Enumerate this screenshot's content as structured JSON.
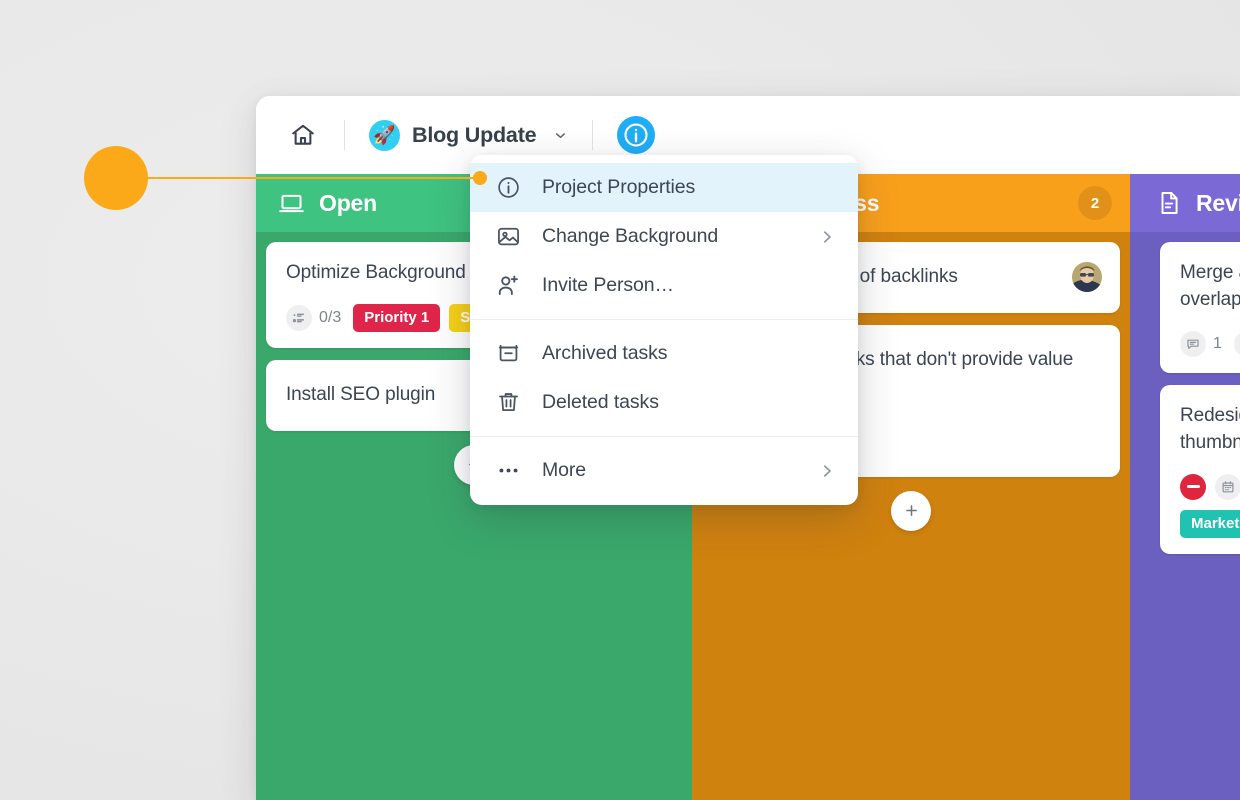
{
  "topbar": {
    "home_icon": "home-icon",
    "project_avatar_glyph": "🚀",
    "project_name": "Blog Update",
    "caret_icon": "chevron-down-icon",
    "info_icon": "info-circle-icon"
  },
  "menu": {
    "items": [
      {
        "label": "Project Properties",
        "icon": "info-circle-icon",
        "active": true,
        "has_submenu": false
      },
      {
        "label": "Change Background",
        "icon": "image-icon",
        "active": false,
        "has_submenu": true
      },
      {
        "label": "Invite Person…",
        "icon": "person-add-icon",
        "active": false,
        "has_submenu": false
      },
      {
        "label": "Archived tasks",
        "icon": "archive-icon",
        "active": false,
        "has_submenu": false
      },
      {
        "label": "Deleted tasks",
        "icon": "trash-icon",
        "active": false,
        "has_submenu": false
      },
      {
        "label": "More",
        "icon": "ellipsis-icon",
        "active": false,
        "has_submenu": true
      }
    ]
  },
  "board": {
    "columns": [
      {
        "title": "Open",
        "icon": "laptop-icon",
        "count": "",
        "header_color": "#3FC380",
        "body_color": "#3AA86B",
        "add_label": "+",
        "cards": [
          {
            "title": "Optimize Background",
            "checklist": "0/3",
            "tags": [
              {
                "label": "Priority 1",
                "color": "#E0254A"
              },
              {
                "label": "SEO",
                "color": "#F7D117"
              }
            ]
          },
          {
            "title": "Install SEO plugin",
            "checklist": "",
            "tags": []
          }
        ]
      },
      {
        "title": "In Progress",
        "icon": "gear-icon",
        "count": "2",
        "header_color": "#F9A01B",
        "body_color": "#D0820F",
        "add_label": "+",
        "cards": [
          {
            "title": "Fix anchor texts of backlinks",
            "has_avatar": true
          },
          {
            "title": "Remove backlinks that don't provide value",
            "has_avatar": false
          }
        ]
      },
      {
        "title": "Review",
        "icon": "document-icon",
        "count": "",
        "header_color": "#7B6AD6",
        "body_color": "#6B5FC0",
        "add_label": "+",
        "cards": [
          {
            "title": "Merge articles that overlap each other",
            "comments": "1",
            "has_checklist_icon": true
          },
          {
            "title": "Redesign blog post thumbnails",
            "blocked": true,
            "has_calendar": true,
            "tags": [
              {
                "label": "Marketing",
                "color": "#20C3B2"
              }
            ]
          }
        ]
      }
    ]
  },
  "annotation": {
    "accent_color": "#FBA919",
    "target": "Project Properties"
  }
}
